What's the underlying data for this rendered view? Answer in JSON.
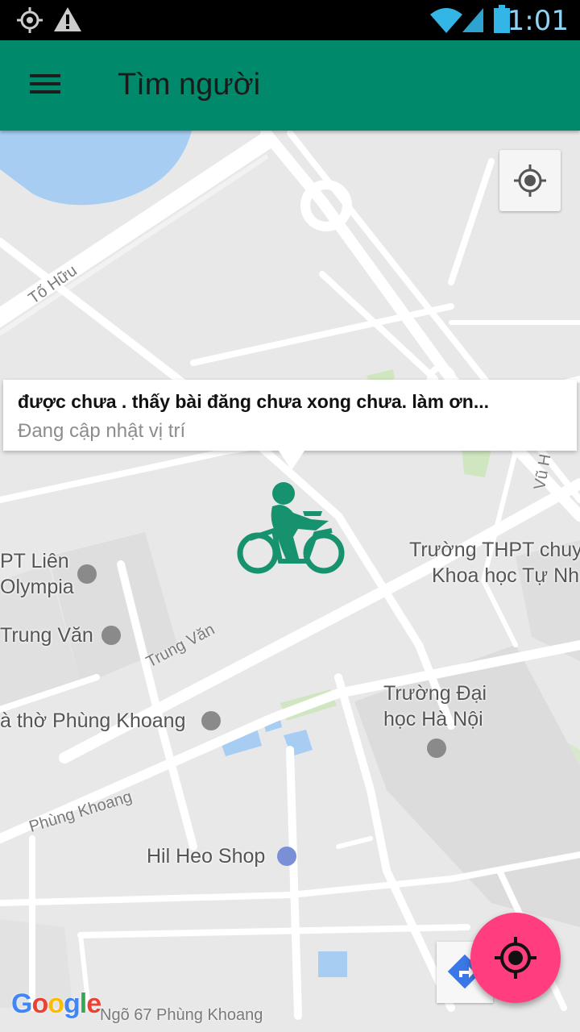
{
  "status_bar": {
    "time": "1:01",
    "icons": [
      "gps-icon",
      "warning-icon",
      "wifi-icon",
      "signal-icon",
      "battery-icon"
    ]
  },
  "app_bar": {
    "title": "Tìm người",
    "menu_icon": "hamburger-menu-icon"
  },
  "info_window": {
    "title": "được chưa . thấy bài đăng chưa xong chưa. làm ơn...",
    "subtitle": "Đang cập nhật vị trí"
  },
  "map": {
    "labels": {
      "to_huu": "Tố Hữu",
      "trung_van_street": "Trung Văn",
      "phung_khoang_street": "Phùng Khoang",
      "ngo_67": "Ngõ 67 Phùng Khoang",
      "vu_hu": "Vũ H",
      "pt_lien": "PT Liên",
      "olympia": "Olympia",
      "trung_van_poi": "Trung Văn",
      "nha_tho": "à thờ Phùng Khoang",
      "truong_thpt_1": "Trường THPT chuy",
      "truong_thpt_2": "Khoa học Tự Nh",
      "truong_dh_1": "Trường Đại",
      "truong_dh_2": "học Hà Nội",
      "hil_heo": "Hil Heo Shop"
    },
    "attribution": "Google"
  },
  "colors": {
    "app_bar": "#00896b",
    "fab": "#ff3d7f",
    "marker": "#16926f",
    "water": "#a7cdf2",
    "park": "#cfe6c0"
  }
}
